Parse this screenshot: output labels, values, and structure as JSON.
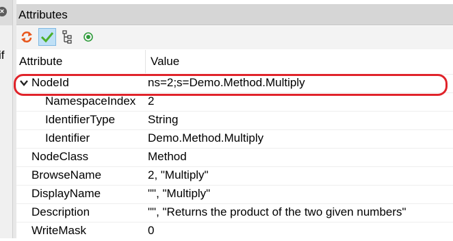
{
  "left_pane": {
    "fragment": "if"
  },
  "panel": {
    "title": "Attributes"
  },
  "toolbar": {
    "buttons": [
      {
        "icon": "refresh-icon"
      },
      {
        "icon": "checkmark-icon"
      },
      {
        "icon": "tree-hierarchy-icon"
      },
      {
        "icon": "radio-target-icon"
      }
    ]
  },
  "grid": {
    "headers": {
      "attribute": "Attribute",
      "value": "Value"
    },
    "rows": [
      {
        "attribute": "NodeId",
        "value": "ns=2;s=Demo.Method.Multiply",
        "expanded": true,
        "highlighted": true
      },
      {
        "attribute": "NamespaceIndex",
        "value": "2",
        "child": true
      },
      {
        "attribute": "IdentifierType",
        "value": "String",
        "child": true
      },
      {
        "attribute": "Identifier",
        "value": "Demo.Method.Multiply",
        "child": true
      },
      {
        "attribute": "NodeClass",
        "value": "Method"
      },
      {
        "attribute": "BrowseName",
        "value": "2, \"Multiply\""
      },
      {
        "attribute": "DisplayName",
        "value": "\"\", \"Multiply\""
      },
      {
        "attribute": "Description",
        "value": "\"\", \"Returns the product of the two given numbers\""
      },
      {
        "attribute": "WriteMask",
        "value": "0"
      }
    ]
  }
}
